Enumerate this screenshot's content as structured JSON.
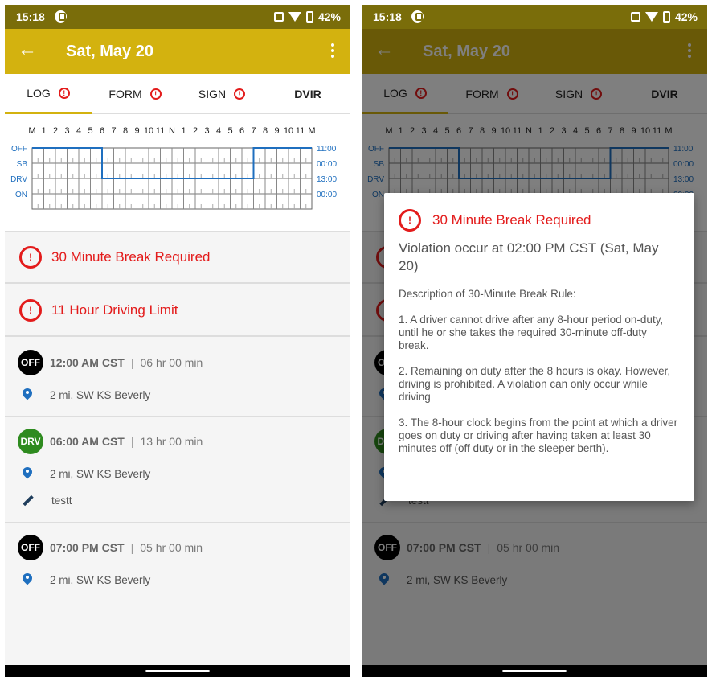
{
  "status_bar": {
    "time": "15:18",
    "battery": "42%"
  },
  "app_bar": {
    "title": "Sat, May 20"
  },
  "tabs": [
    {
      "label": "LOG",
      "alert": "!"
    },
    {
      "label": "FORM",
      "alert": "!"
    },
    {
      "label": "SIGN",
      "alert": "!"
    },
    {
      "label": "DVIR"
    }
  ],
  "log_chart": {
    "hour_labels": [
      "M",
      "1",
      "2",
      "3",
      "4",
      "5",
      "6",
      "7",
      "8",
      "9",
      "10",
      "11",
      "N",
      "1",
      "2",
      "3",
      "4",
      "5",
      "6",
      "7",
      "8",
      "9",
      "10",
      "11",
      "M"
    ],
    "rows": [
      "OFF",
      "SB",
      "DRV",
      "ON"
    ],
    "totals": [
      "11:00",
      "00:00",
      "13:00",
      "00:00"
    ],
    "segments": [
      {
        "status": "OFF",
        "from_hour": 0,
        "to_hour": 6
      },
      {
        "status": "DRV",
        "from_hour": 6,
        "to_hour": 19
      },
      {
        "status": "OFF",
        "from_hour": 19,
        "to_hour": 24
      }
    ],
    "line_color": "#1f6fbf"
  },
  "violations": [
    {
      "icon": "!",
      "label": "30 Minute Break Required"
    },
    {
      "icon": "!",
      "label": "11 Hour Driving Limit"
    }
  ],
  "entries": [
    {
      "badge": "OFF",
      "time": "12:00 AM CST",
      "sep": "|",
      "duration": "06 hr  00 min",
      "location": "2 mi, SW KS Beverly"
    },
    {
      "badge": "DRV",
      "time": "06:00 AM CST",
      "sep": "|",
      "duration": "13 hr  00 min",
      "location": "2 mi, SW KS Beverly",
      "note": "testt"
    },
    {
      "badge": "OFF",
      "time": "07:00 PM CST",
      "sep": "|",
      "duration": "05 hr  00 min",
      "location": "2 mi, SW KS Beverly"
    }
  ],
  "dialog": {
    "icon": "!",
    "title": "30 Minute Break Required",
    "subtitle": "Violation occur at 02:00 PM CST (Sat, May 20)",
    "paragraphs": [
      "Description of 30-Minute Break Rule:",
      "1. A driver cannot drive after any 8-hour period on-duty, until he or she takes the required 30-minute off-duty break.",
      "2. Remaining on duty after the 8 hours is okay. However, driving is prohibited. A violation can only occur while driving",
      "3. The 8-hour clock begins from the point at which a driver goes on duty or driving after having taken at least 30 minutes off (off duty or in the sleeper berth)."
    ]
  },
  "colors": {
    "app_bar": "#d3b20f",
    "status_bar": "#7a6d0a",
    "alert": "#e31b1b",
    "drv_badge": "#2e8b1f",
    "off_badge": "#000000",
    "pin": "#1f6fbf"
  }
}
